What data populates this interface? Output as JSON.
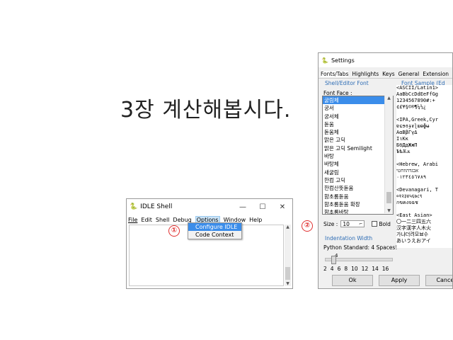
{
  "slide_title": "3장 계산해봅시다.",
  "markers": {
    "one": "①",
    "two": "②"
  },
  "idle": {
    "window_title": "IDLE Shell",
    "controls": [
      "—",
      "☐",
      "✕"
    ],
    "menu": [
      "File",
      "Edit",
      "Shell",
      "Debug",
      "Options",
      "Window",
      "Help"
    ],
    "dropdown": [
      "Configure IDLE",
      "Code Context"
    ]
  },
  "settings": {
    "window_title": "Settings",
    "tabs": [
      "Fonts/Tabs",
      "Highlights",
      "Keys",
      "General",
      "Extension"
    ],
    "shell_editor_font": "Shell/Editor Font",
    "font_sample_label": "Font Sample (Ed",
    "font_face_label": "Font Face :",
    "fonts": [
      "굴림체",
      "궁서",
      "궁서체",
      "돋움",
      "돋움체",
      "맑은 고딕",
      "맑은 고딕 Semilight",
      "바탕",
      "바탕체",
      "새굴림",
      "한컴 고딕",
      "한컴산뜻돋움",
      "함초롬돋움",
      "함초롬돋움 확장",
      "함초롬바탕"
    ],
    "size_label": "Size :",
    "size_value": "10",
    "bold_label": "Bold",
    "indentation_label": "Indentation Width",
    "python_standard": "Python Standard: 4 Spaces!",
    "indent_value": "4",
    "ticks": [
      "2",
      "4",
      "6",
      "8",
      "10",
      "12",
      "14",
      "16"
    ],
    "sample_lines": [
      "<ASCII/Latin1>",
      "AaBbCcDdEeFfGg",
      "1234567890#:+",
      "¢£¥§©®¶¼½¿",
      "",
      "<IPA,Greek,Cyr",
      "ɐɕɘɞɟɤɭɯɵɸʉ",
      "ΑαΒβΓγΔ",
      "ΙιΚκ",
      "БбДдЖжП",
      "ѢѣѪѫ",
      "",
      "<Hebrew, Arabi",
      "אבגדהוזחטי",
      "٠١٢٣٤٥٦٧٨٩",
      "",
      "<Devanagari, T",
      "०१२३४५६७८९",
      "กขคงจฉช",
      "",
      "<East Asian>",
      "〇一二三四五六",
      "汉字漢字人木火",
      "가냐더려모뵤수",
      "あいうえおアイ"
    ],
    "buttons": [
      "Ok",
      "Apply",
      "Cancel"
    ]
  }
}
